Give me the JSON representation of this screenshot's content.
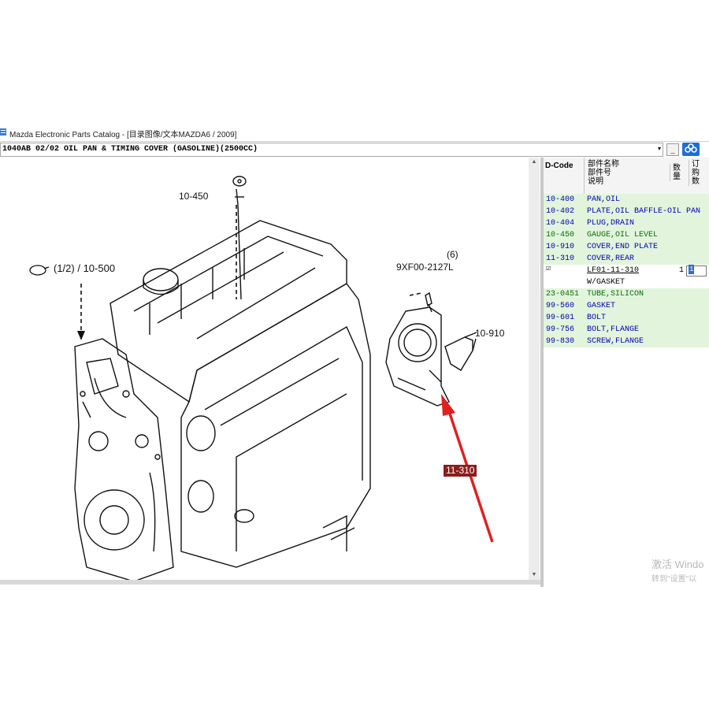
{
  "window": {
    "title": "Mazda Electronic Parts Catalog - [目录图像/文本MAZDA6 / 2009]"
  },
  "toolbar": {
    "figure_select_value": "1040AB 02/02 OIL PAN & TIMING COVER (GASOLINE)(2500CC)",
    "minimize_glyph": "_",
    "restore_glyph": "□",
    "dropdown_glyph": "▾"
  },
  "diagram": {
    "callouts": {
      "gauge": "10-450",
      "cover_ref": "(1/2) / 10-500",
      "bolt_part": "9XF00-2127L",
      "bolt_qty": "(6)",
      "rear_cover": "11-310",
      "end_plate": "10-910"
    },
    "colors": {
      "arrow": "#e02020",
      "highlight": "#8b1d1d"
    }
  },
  "parts_table": {
    "headers": {
      "dcode": "D-Code",
      "desc_line1": "部件名称",
      "desc_line2": "部件号",
      "desc_line3": "说明",
      "qty": "数量",
      "order": "订购数"
    },
    "rows": [
      {
        "code": "10-400",
        "name": "PAN,OIL"
      },
      {
        "code": "10-402",
        "name": "PLATE,OIL BAFFLE-OIL PAN"
      },
      {
        "code": "10-404",
        "name": "PLUG,DRAIN"
      },
      {
        "code": "10-450",
        "name": "GAUGE,OIL LEVEL"
      },
      {
        "code": "10-910",
        "name": "COVER,END PLATE"
      },
      {
        "code": "11-310",
        "name": "COVER,REAR"
      }
    ],
    "selected": {
      "checkbox": "☑",
      "part_number": "LF01-11-310",
      "qty": "1",
      "order_value": "1",
      "note": "W/GASKET"
    },
    "rows_after": [
      {
        "code": "23-0451",
        "name": "TUBE,SILICON"
      },
      {
        "code": "99-560",
        "name": "GASKET"
      },
      {
        "code": "99-601",
        "name": "BOLT"
      },
      {
        "code": "99-756",
        "name": "BOLT,FLANGE"
      },
      {
        "code": "99-830",
        "name": "SCREW,FLANGE"
      }
    ]
  },
  "watermark": {
    "line1": "激活 Windo",
    "line2": "转到\"设置\"以"
  }
}
